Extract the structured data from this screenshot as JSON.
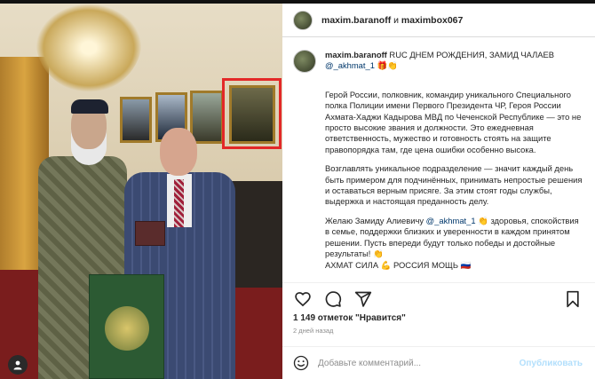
{
  "header": {
    "user1": "maxim.baranoff",
    "joiner": "и",
    "user2": "maximbox067"
  },
  "caption": {
    "username": "maxim.baranoff",
    "title": "RUC ДНЕМ РОЖДЕНИЯ, ЗАМИД ЧАЛАЕВ",
    "title_mention": "@_akhmat_1",
    "title_emojis": "🎁👏",
    "paragraphs": [
      "Герой России, полковник, командир уникального Специального полка Полиции имени Первого Президента ЧР, Героя России Ахмата-Хаджи Кадырова МВД по Чеченской Республике — это не просто высокие звания и должности. Это ежедневная ответственность, мужество и готовность стоять на защите правопорядка там, где цена ошибки особенно высока.",
      "Возглавлять уникальное подразделение — значит каждый день быть примером для подчинённых, принимать непростые решения и оставаться верным присяге. За этим стоят годы службы, выдержка и настоящая преданность делу."
    ],
    "wish_prefix": "Желаю Замиду Алиевичу",
    "wish_mention": "@_akhmat_1",
    "wish_rest": "👏 здоровья, спокойствия в семье, поддержки близких и уверенности в каждом принятом решении. Пусть впереди будут только победы и достойные результаты! 👏",
    "cut_line": "АХМАТ СИЛА 💪 РОССИЯ МОЩЬ 🇷🇺"
  },
  "actions": {
    "icons": [
      "heart-icon",
      "comment-icon",
      "share-icon",
      "bookmark-icon"
    ]
  },
  "likes": "1 149 отметок \"Нравится\"",
  "time": "2 дней назад",
  "comment": {
    "placeholder": "Добавьте комментарий...",
    "post_label": "Опубликовать"
  },
  "photo": {
    "user_tag_icon": "user-tag-icon"
  },
  "colors": {
    "highlight_box": "#e32828",
    "mention": "#00376b",
    "post_disabled": "#b2dffc"
  }
}
